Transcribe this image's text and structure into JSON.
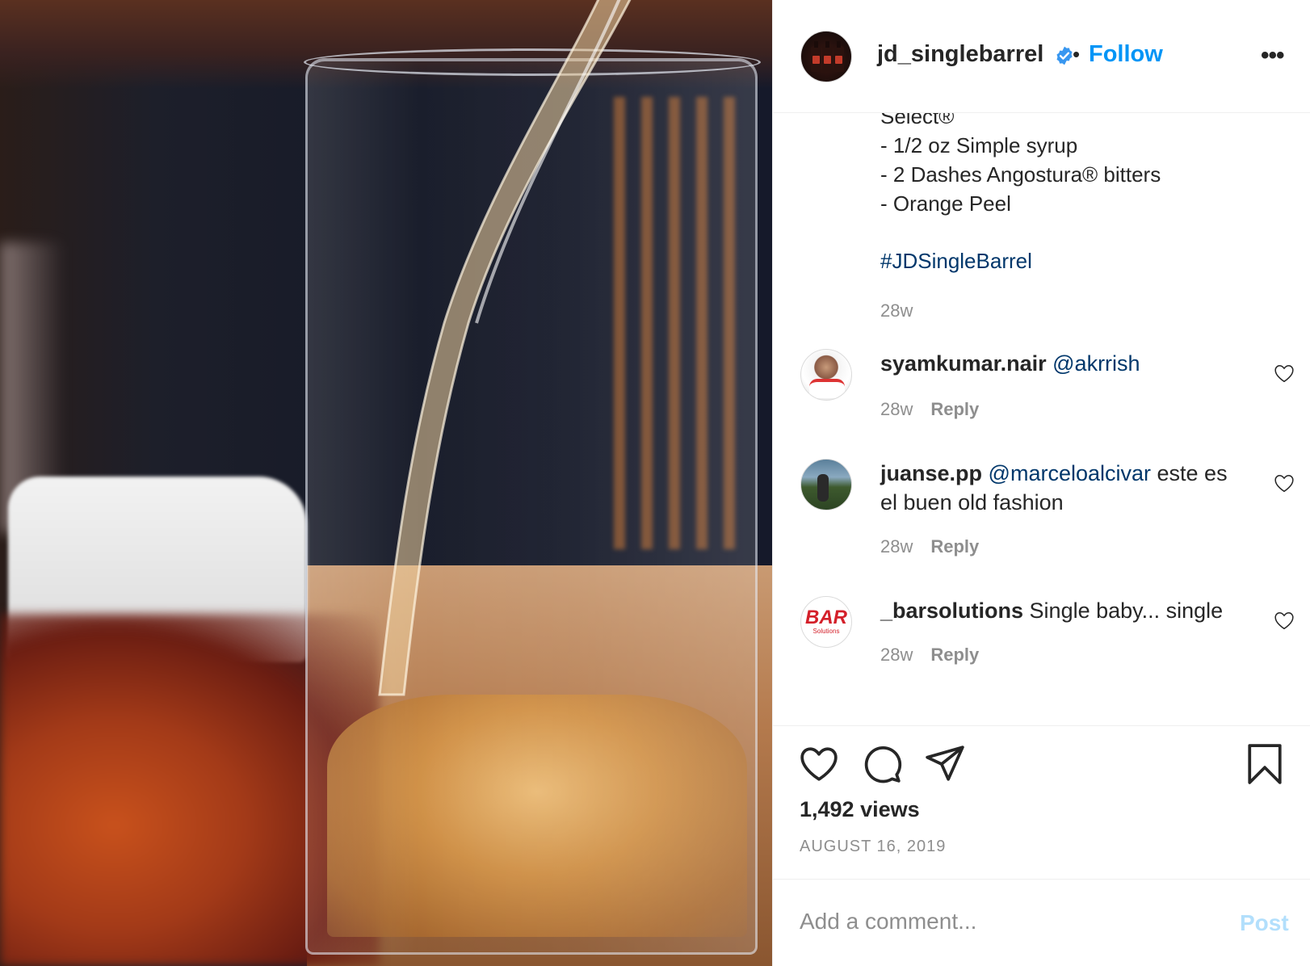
{
  "post": {
    "username": "jd_singlebarrel",
    "verified_icon": "verified-badge-icon",
    "separator": "•",
    "follow_label": "Follow",
    "more_label": "•••"
  },
  "caption": {
    "lines": [
      "Select®",
      "- 1/2 oz Simple syrup",
      "- 2 Dashes Angostura® bitters",
      "- Orange Peel"
    ],
    "hashtag": "#JDSingleBarrel",
    "time": "28w"
  },
  "comments": [
    {
      "username": "syamkumar.nair",
      "mention": "@akrrish",
      "text": "",
      "time": "28w",
      "reply_label": "Reply"
    },
    {
      "username": "juanse.pp",
      "mention": "@marceloalcivar",
      "text": " este es el buen old fashion",
      "time": "28w",
      "reply_label": "Reply"
    },
    {
      "username": "_barsolutions",
      "mention": "",
      "text": "Single baby... single",
      "time": "28w",
      "reply_label": "Reply",
      "avatar_logo": "BAR",
      "avatar_logo_sub": "Solutions"
    }
  ],
  "actions": {
    "views": "1,492 views",
    "date": "AUGUST 16, 2019",
    "icons": [
      "heart-icon",
      "comment-icon",
      "share-icon",
      "bookmark-icon"
    ]
  },
  "add_comment": {
    "placeholder": "Add a comment...",
    "post_label": "Post"
  },
  "colors": {
    "link_blue": "#0095f6",
    "mention_navy": "#00376b",
    "muted_gray": "#8e8e8e",
    "post_disabled": "#b2dffc"
  }
}
